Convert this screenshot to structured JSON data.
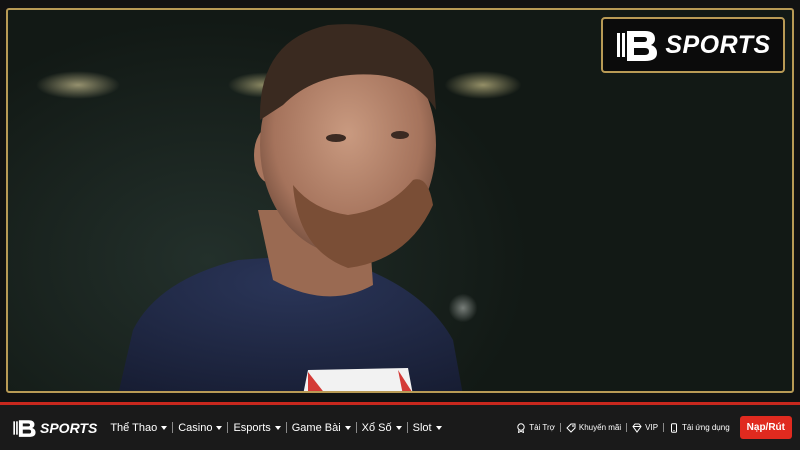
{
  "brand": {
    "logo_text": "SPORTS",
    "colors": {
      "gold": "#b89a55",
      "accent_red": "#e02a1f",
      "navbar_bg": "#1a1a1a"
    }
  },
  "hero": {
    "image_alt": "Cầu thủ bóng đá"
  },
  "navbar": {
    "menu": [
      {
        "label": "Thể Thao",
        "has_dropdown": true
      },
      {
        "label": "Casino",
        "has_dropdown": true
      },
      {
        "label": "Esports",
        "has_dropdown": true
      },
      {
        "label": "Game Bài",
        "has_dropdown": true
      },
      {
        "label": "Xổ Số",
        "has_dropdown": true
      },
      {
        "label": "Slot",
        "has_dropdown": true
      }
    ],
    "links": [
      {
        "label": "Tài Trợ",
        "icon": "sponsor-icon"
      },
      {
        "label": "Khuyến mãi",
        "icon": "tag-icon"
      },
      {
        "label": "VIP",
        "icon": "diamond-icon"
      },
      {
        "label": "Tải ứng dụng",
        "icon": "phone-icon"
      }
    ],
    "cta_label": "Nạp/Rút"
  }
}
